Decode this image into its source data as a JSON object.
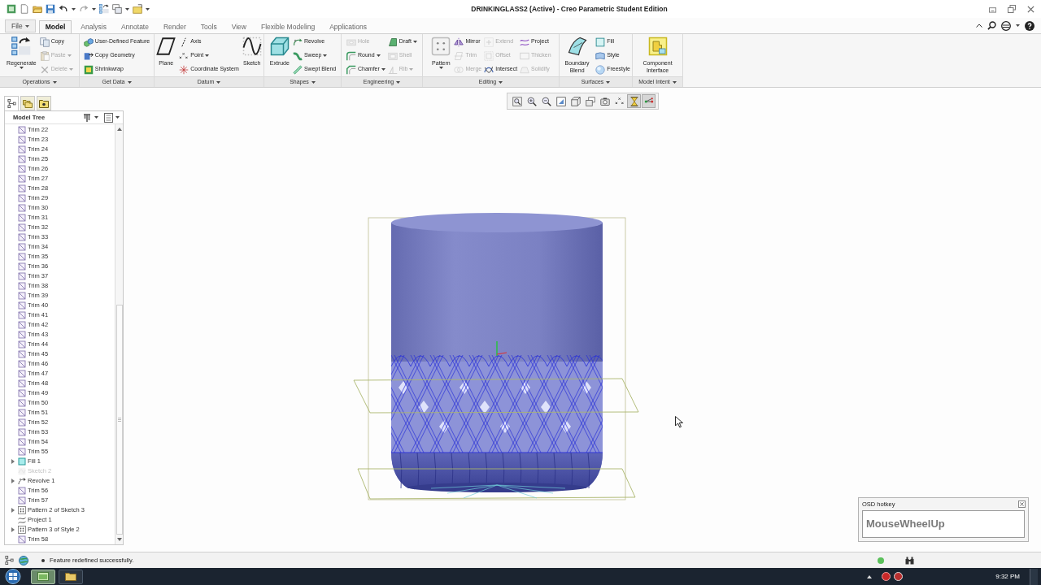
{
  "window": {
    "title": "DRINKINGLASS2 (Active) - Creo Parametric Student Edition"
  },
  "tabs": [
    {
      "label": "File",
      "selected": false,
      "dropdown": true
    },
    {
      "label": "Model",
      "selected": true,
      "dropdown": false
    },
    {
      "label": "Analysis",
      "selected": false,
      "dropdown": false
    },
    {
      "label": "Annotate",
      "selected": false,
      "dropdown": false
    },
    {
      "label": "Render",
      "selected": false,
      "dropdown": false
    },
    {
      "label": "Tools",
      "selected": false,
      "dropdown": false
    },
    {
      "label": "View",
      "selected": false,
      "dropdown": false
    },
    {
      "label": "Flexible Modeling",
      "selected": false,
      "dropdown": false
    },
    {
      "label": "Applications",
      "selected": false,
      "dropdown": false
    }
  ],
  "ribbon": {
    "groups": [
      {
        "label": "Operations",
        "columns": [
          [
            {
              "label": "Regenerate",
              "kind": "large",
              "dropdown": true,
              "disabled": false
            }
          ],
          [
            {
              "label": "Copy",
              "kind": "small",
              "dropdown": false,
              "disabled": false
            },
            {
              "label": "Paste",
              "kind": "small",
              "dropdown": true,
              "disabled": true
            },
            {
              "label": "Delete",
              "kind": "small",
              "dropdown": true,
              "disabled": true
            }
          ]
        ]
      },
      {
        "label": "Get Data",
        "columns": [
          [
            {
              "label": "User-Defined Feature",
              "kind": "small",
              "dropdown": false,
              "disabled": false
            },
            {
              "label": "Copy Geometry",
              "kind": "small",
              "dropdown": false,
              "disabled": false
            },
            {
              "label": "Shrinkwrap",
              "kind": "small",
              "dropdown": false,
              "disabled": false
            }
          ]
        ]
      },
      {
        "label": "Datum",
        "columns": [
          [
            {
              "label": "Plane",
              "kind": "large",
              "dropdown": false,
              "disabled": false
            }
          ],
          [
            {
              "label": "Axis",
              "kind": "small",
              "dropdown": false,
              "disabled": false
            },
            {
              "label": "Point",
              "kind": "small",
              "dropdown": true,
              "disabled": false
            },
            {
              "label": "Coordinate System",
              "kind": "small",
              "dropdown": false,
              "disabled": false
            }
          ],
          [
            {
              "label": "Sketch",
              "kind": "large",
              "dropdown": false,
              "disabled": false
            }
          ]
        ]
      },
      {
        "label": "Shapes",
        "columns": [
          [
            {
              "label": "Extrude",
              "kind": "large",
              "dropdown": false,
              "disabled": false
            }
          ],
          [
            {
              "label": "Revolve",
              "kind": "small",
              "dropdown": false,
              "disabled": false
            },
            {
              "label": "Sweep",
              "kind": "small",
              "dropdown": true,
              "disabled": false
            },
            {
              "label": "Swept Blend",
              "kind": "small",
              "dropdown": false,
              "disabled": false
            }
          ]
        ]
      },
      {
        "label": "Engineering",
        "columns": [
          [
            {
              "label": "Hole",
              "kind": "small",
              "dropdown": false,
              "disabled": true
            },
            {
              "label": "Round",
              "kind": "small",
              "dropdown": true,
              "disabled": false
            },
            {
              "label": "Chamfer",
              "kind": "small",
              "dropdown": true,
              "disabled": false
            }
          ],
          [
            {
              "label": "Draft",
              "kind": "small",
              "dropdown": true,
              "disabled": false
            },
            {
              "label": "Shell",
              "kind": "small",
              "dropdown": false,
              "disabled": true
            },
            {
              "label": "Rib",
              "kind": "small",
              "dropdown": true,
              "disabled": true
            }
          ]
        ]
      },
      {
        "label": "Editing",
        "columns": [
          [
            {
              "label": "Pattern",
              "kind": "large",
              "dropdown": true,
              "disabled": false
            }
          ],
          [
            {
              "label": "Mirror",
              "kind": "small",
              "dropdown": false,
              "disabled": false
            },
            {
              "label": "Trim",
              "kind": "small",
              "dropdown": false,
              "disabled": true
            },
            {
              "label": "Merge",
              "kind": "small",
              "dropdown": false,
              "disabled": true
            }
          ],
          [
            {
              "label": "Extend",
              "kind": "small",
              "dropdown": false,
              "disabled": true
            },
            {
              "label": "Offset",
              "kind": "small",
              "dropdown": false,
              "disabled": true
            },
            {
              "label": "Intersect",
              "kind": "small",
              "dropdown": false,
              "disabled": false
            }
          ],
          [
            {
              "label": "Project",
              "kind": "small",
              "dropdown": false,
              "disabled": false
            },
            {
              "label": "Thicken",
              "kind": "small",
              "dropdown": false,
              "disabled": true
            },
            {
              "label": "Solidify",
              "kind": "small",
              "dropdown": false,
              "disabled": true
            }
          ]
        ]
      },
      {
        "label": "Surfaces",
        "columns": [
          [
            {
              "label": "Boundary Blend",
              "kind": "large",
              "dropdown": false,
              "disabled": false
            }
          ],
          [
            {
              "label": "Fill",
              "kind": "small",
              "dropdown": false,
              "disabled": false
            },
            {
              "label": "Style",
              "kind": "small",
              "dropdown": false,
              "disabled": false
            },
            {
              "label": "Freestyle",
              "kind": "small",
              "dropdown": false,
              "disabled": false
            }
          ]
        ]
      },
      {
        "label": "Model Intent",
        "columns": [
          [
            {
              "label": "Component Interface",
              "kind": "large",
              "dropdown": false,
              "disabled": false
            }
          ]
        ]
      }
    ]
  },
  "navigator": {
    "tabs": [
      {
        "selected": true
      },
      {
        "selected": false
      },
      {
        "selected": false
      }
    ],
    "title": "Model Tree"
  },
  "model_tree": [
    {
      "label": "Trim 22",
      "kind": "trim",
      "expandable": false,
      "hidden": false
    },
    {
      "label": "Trim 23",
      "kind": "trim",
      "expandable": false,
      "hidden": false
    },
    {
      "label": "Trim 24",
      "kind": "trim",
      "expandable": false,
      "hidden": false
    },
    {
      "label": "Trim 25",
      "kind": "trim",
      "expandable": false,
      "hidden": false
    },
    {
      "label": "Trim 26",
      "kind": "trim",
      "expandable": false,
      "hidden": false
    },
    {
      "label": "Trim 27",
      "kind": "trim",
      "expandable": false,
      "hidden": false
    },
    {
      "label": "Trim 28",
      "kind": "trim",
      "expandable": false,
      "hidden": false
    },
    {
      "label": "Trim 29",
      "kind": "trim",
      "expandable": false,
      "hidden": false
    },
    {
      "label": "Trim 30",
      "kind": "trim",
      "expandable": false,
      "hidden": false
    },
    {
      "label": "Trim 31",
      "kind": "trim",
      "expandable": false,
      "hidden": false
    },
    {
      "label": "Trim 32",
      "kind": "trim",
      "expandable": false,
      "hidden": false
    },
    {
      "label": "Trim 33",
      "kind": "trim",
      "expandable": false,
      "hidden": false
    },
    {
      "label": "Trim 34",
      "kind": "trim",
      "expandable": false,
      "hidden": false
    },
    {
      "label": "Trim 35",
      "kind": "trim",
      "expandable": false,
      "hidden": false
    },
    {
      "label": "Trim 36",
      "kind": "trim",
      "expandable": false,
      "hidden": false
    },
    {
      "label": "Trim 37",
      "kind": "trim",
      "expandable": false,
      "hidden": false
    },
    {
      "label": "Trim 38",
      "kind": "trim",
      "expandable": false,
      "hidden": false
    },
    {
      "label": "Trim 39",
      "kind": "trim",
      "expandable": false,
      "hidden": false
    },
    {
      "label": "Trim 40",
      "kind": "trim",
      "expandable": false,
      "hidden": false
    },
    {
      "label": "Trim 41",
      "kind": "trim",
      "expandable": false,
      "hidden": false
    },
    {
      "label": "Trim 42",
      "kind": "trim",
      "expandable": false,
      "hidden": false
    },
    {
      "label": "Trim 43",
      "kind": "trim",
      "expandable": false,
      "hidden": false
    },
    {
      "label": "Trim 44",
      "kind": "trim",
      "expandable": false,
      "hidden": false
    },
    {
      "label": "Trim 45",
      "kind": "trim",
      "expandable": false,
      "hidden": false
    },
    {
      "label": "Trim 46",
      "kind": "trim",
      "expandable": false,
      "hidden": false
    },
    {
      "label": "Trim 47",
      "kind": "trim",
      "expandable": false,
      "hidden": false
    },
    {
      "label": "Trim 48",
      "kind": "trim",
      "expandable": false,
      "hidden": false
    },
    {
      "label": "Trim 49",
      "kind": "trim",
      "expandable": false,
      "hidden": false
    },
    {
      "label": "Trim 50",
      "kind": "trim",
      "expandable": false,
      "hidden": false
    },
    {
      "label": "Trim 51",
      "kind": "trim",
      "expandable": false,
      "hidden": false
    },
    {
      "label": "Trim 52",
      "kind": "trim",
      "expandable": false,
      "hidden": false
    },
    {
      "label": "Trim 53",
      "kind": "trim",
      "expandable": false,
      "hidden": false
    },
    {
      "label": "Trim 54",
      "kind": "trim",
      "expandable": false,
      "hidden": false
    },
    {
      "label": "Trim 55",
      "kind": "trim",
      "expandable": false,
      "hidden": false
    },
    {
      "label": "Fill 1",
      "kind": "fill",
      "expandable": true,
      "hidden": false
    },
    {
      "label": "Sketch 2",
      "kind": "sketch",
      "expandable": false,
      "hidden": true
    },
    {
      "label": "Revolve 1",
      "kind": "revolve",
      "expandable": true,
      "hidden": false
    },
    {
      "label": "Trim 56",
      "kind": "trim",
      "expandable": false,
      "hidden": false
    },
    {
      "label": "Trim 57",
      "kind": "trim",
      "expandable": false,
      "hidden": false
    },
    {
      "label": "Pattern 2 of Sketch 3",
      "kind": "pattern",
      "expandable": true,
      "hidden": false
    },
    {
      "label": "Project 1",
      "kind": "project",
      "expandable": false,
      "hidden": false
    },
    {
      "label": "Pattern 3 of Style 2",
      "kind": "pattern",
      "expandable": true,
      "hidden": false
    },
    {
      "label": "Trim 58",
      "kind": "trim",
      "expandable": false,
      "hidden": false
    }
  ],
  "view_toolbar": [
    {
      "pressed": false
    },
    {
      "pressed": false
    },
    {
      "pressed": false
    },
    {
      "pressed": false
    },
    {
      "pressed": false
    },
    {
      "pressed": false
    },
    {
      "pressed": false
    },
    {
      "pressed": false
    },
    {
      "pressed": true
    },
    {
      "pressed": true
    }
  ],
  "hotkey_overlay": {
    "title": "OSD hotkey",
    "text": "MouseWheelUp"
  },
  "status_bar": {
    "message": "Feature redefined successfully."
  },
  "taskbar": {
    "apps": [
      {
        "selected": true
      },
      {
        "selected": false
      }
    ],
    "clock": "9:32 PM"
  }
}
